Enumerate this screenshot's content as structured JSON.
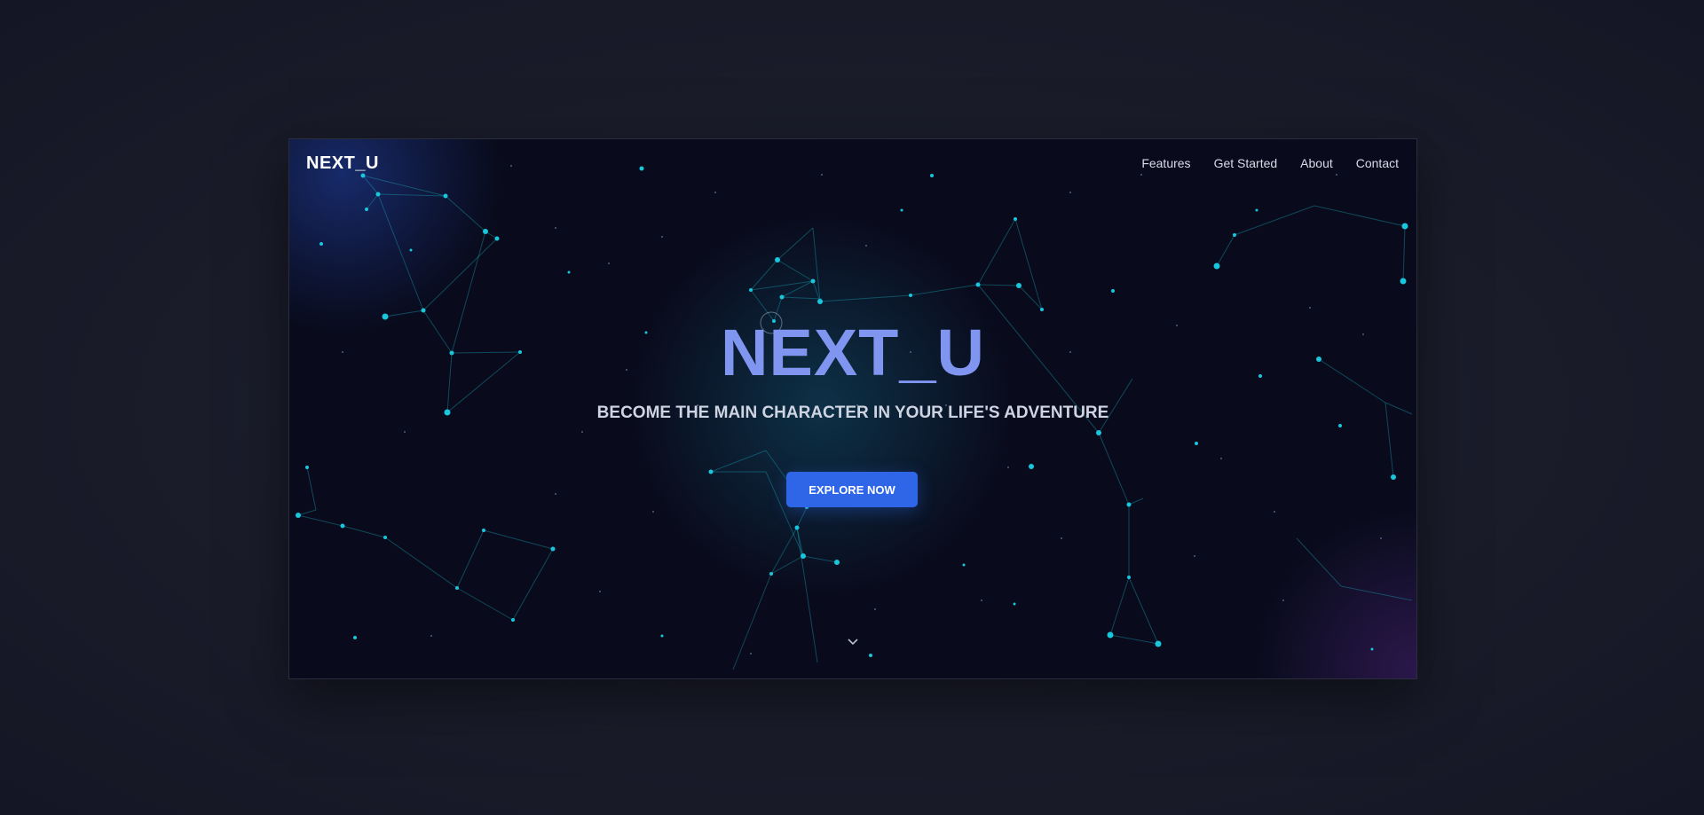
{
  "nav": {
    "logo": "NEXT_U",
    "items": [
      "Features",
      "Get Started",
      "About",
      "Contact"
    ]
  },
  "hero": {
    "title": "NEXT_U",
    "subtitle": "BECOME THE MAIN CHARACTER IN YOUR LIFE'S ADVENTURE",
    "cta_label": "EXPLORE NOW"
  },
  "icons": {
    "scroll": "chevron-down-icon"
  },
  "colors": {
    "background": "#090b1c",
    "accent": "#2f66e8",
    "title": "#7f95f0",
    "particle": "#19c6dc"
  }
}
